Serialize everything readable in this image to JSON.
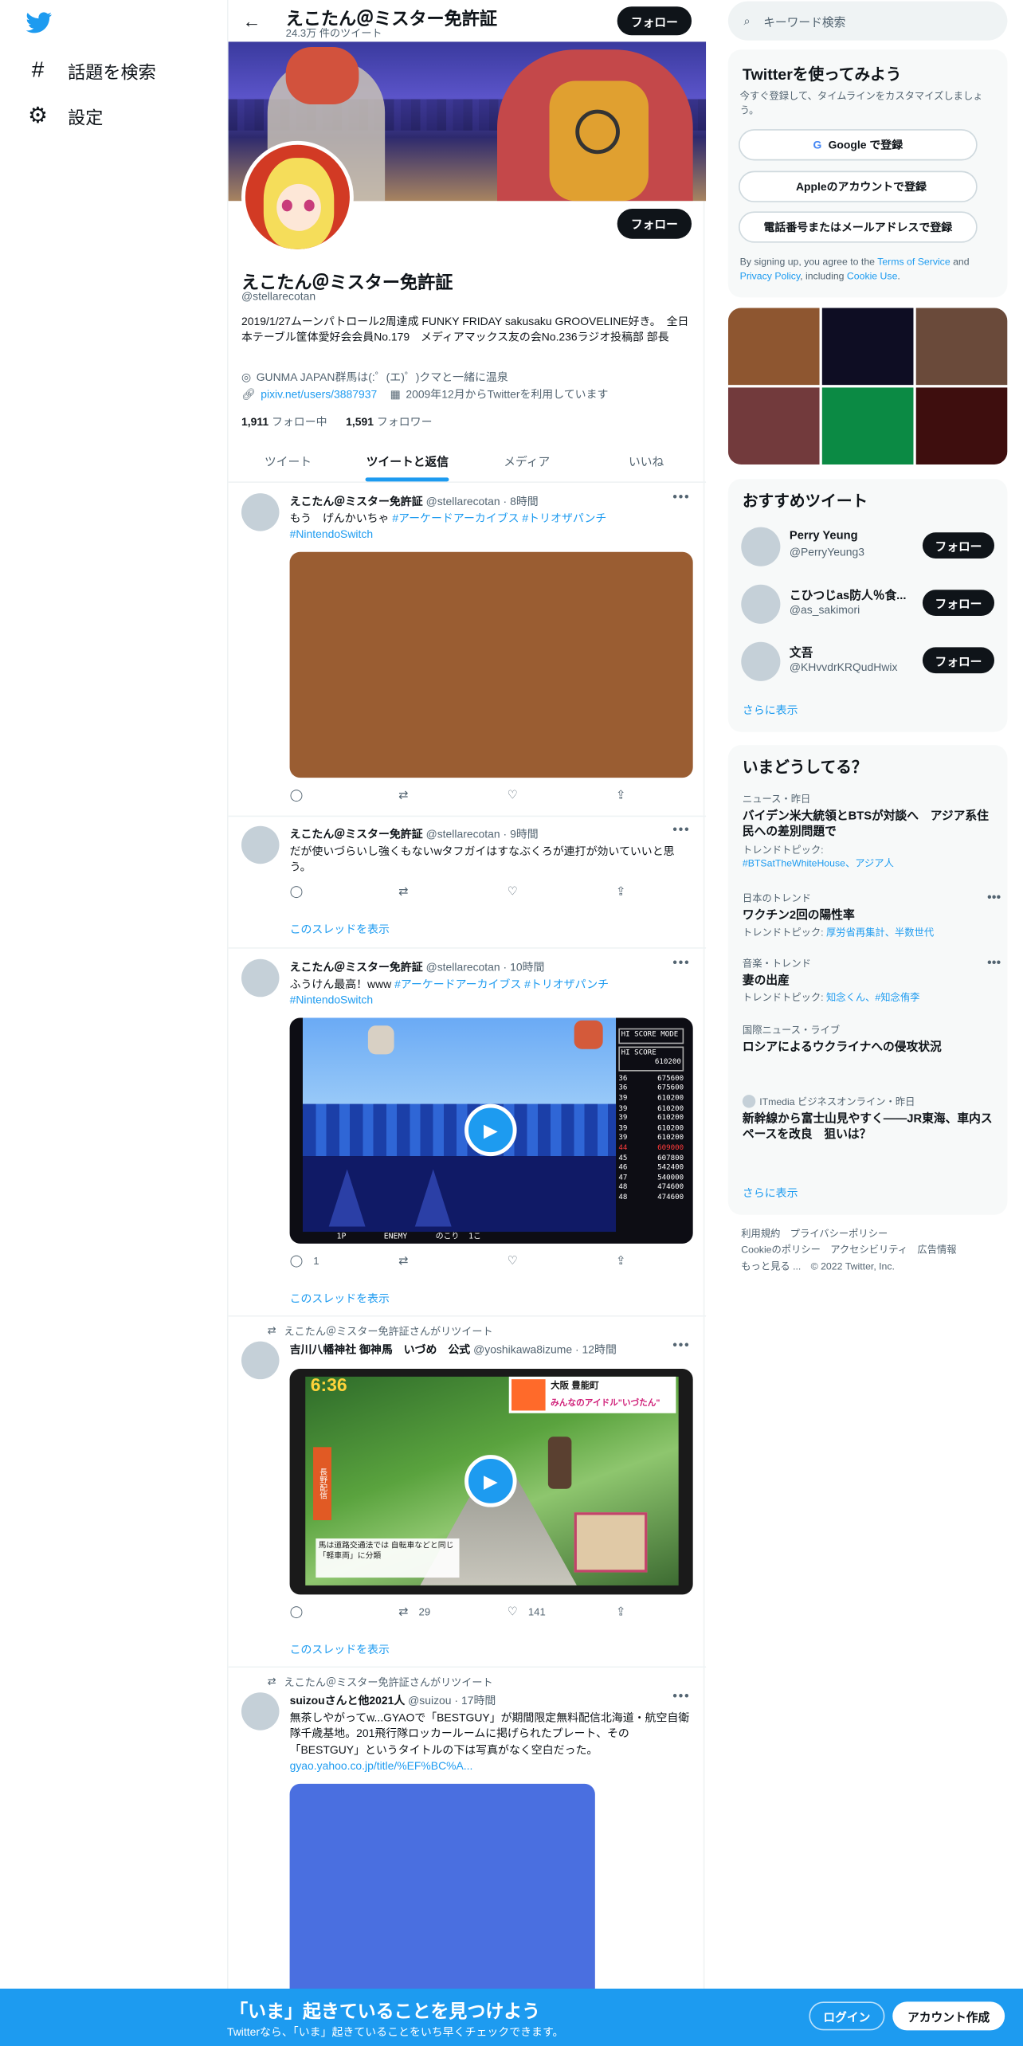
{
  "nav": {
    "explore_label": "話題を検索",
    "settings_label": "設定"
  },
  "header": {
    "name": "えこたん＠ミスター免許証",
    "tweet_count": "24.3万 件のツイート",
    "follow_label": "フォロー"
  },
  "profile": {
    "name": "えこたん＠ミスター免許証",
    "handle": "@stellarecotan",
    "bio": "2019/1/27ムーンパトロール2周達成 FUNKY FRIDAY sakusaku GROOVELINE好き。　全日本テーブル筐体愛好会会員No.179　メディアマックス友の会No.236ラジオ投稿部 部長",
    "location": "GUNMA JAPAN群馬は(:゜(エ)゜)クマと一緒に温泉",
    "url": "pixiv.net/users/3887937",
    "joined": "2009年12月からTwitterを利用しています",
    "following_count": "1,911",
    "following_label": "フォロー中",
    "followers_count": "1,591",
    "followers_label": "フォロワー",
    "follow_label": "フォロー"
  },
  "tabs": [
    {
      "label": "ツイート"
    },
    {
      "label": "ツイートと返信"
    },
    {
      "label": "メディア"
    },
    {
      "label": "いいね"
    }
  ],
  "tweets": [
    {
      "name": "えこたん＠ミスター免許証",
      "handle": "@stellarecotan",
      "time": "8時間",
      "text_plain": "もう　げんかいちゃ ",
      "tags": "#アーケードアーカイブス #トリオザパンチ",
      "tags2": "#NintendoSwitch"
    },
    {
      "name": "えこたん＠ミスター免許証",
      "handle": "@stellarecotan",
      "time": "9時間",
      "text": "だが使いづらいし強くもないwタフガイはすなぶくろが連打が効いていいと思う。",
      "thread_label": "このスレッドを表示"
    },
    {
      "name": "えこたん＠ミスター免許証",
      "handle": "@stellarecotan",
      "time": "10時間",
      "text_plain": "ふうけん最高！www ",
      "tags": "#アーケードアーカイブス #トリオザパンチ",
      "tags2": "#NintendoSwitch",
      "reply_count": "1",
      "thread_label": "このスレッドを表示"
    },
    {
      "rt_label": "えこたん＠ミスター免許証さんがリツイート",
      "name": "吉川八幡神社 御神馬　いづめ　公式",
      "handle": "@yoshikawa8izume",
      "time": "12時間",
      "retweet_count": "29",
      "like_count": "141",
      "thread_label": "このスレッドを表示"
    },
    {
      "rt_label": "えこたん＠ミスター免許証さんがリツイート",
      "name": "suizouさんと他2021人",
      "handle": "@suizou",
      "time": "17時間",
      "text": "無茶しやがってw...GYAOで「BESTGUY」が期間限定無料配信北海道・航空自衛隊千歳基地。201飛行隊ロッカールームに掲げられたプレート、その「BESTGUY」というタイトルの下は写真がなく空白だった。",
      "link": "gyao.yahoo.co.jp/title/%EF%BC%A..."
    }
  ],
  "game_scores": [
    [
      "36",
      "675600"
    ],
    [
      "36",
      "675600"
    ],
    [
      "39",
      "610200"
    ],
    [
      "39",
      "610200"
    ],
    [
      "39",
      "610200"
    ],
    [
      "39",
      "610200"
    ],
    [
      "39",
      "610200"
    ],
    [
      "44",
      "609000"
    ],
    [
      "45",
      "607800"
    ],
    [
      "46",
      "542400"
    ],
    [
      "47",
      "540000"
    ],
    [
      "48",
      "474600"
    ],
    [
      "48",
      "474600"
    ]
  ],
  "game": {
    "hi_score_label": "HI SCORE MODE",
    "hi_label": "HI SCORE",
    "hi_value": "610200",
    "bottom": "1P        ENEMY      のこり  1こ"
  },
  "video2": {
    "time": "6:36",
    "side": "長野配信",
    "caption": "馬は道路交通法では 自転車などと同じ「軽車両」に分類",
    "brand": "みんなのアイドル\"いづたん\"",
    "location": "大阪 豊能町"
  },
  "right": {
    "search_placeholder": "キーワード検索",
    "signup_title": "Twitterを使ってみよう",
    "signup_desc": "今すぐ登録して、タイムラインをカスタマイズしましょう。",
    "google_label": "Google で登録",
    "apple_label": "Appleのアカウントで登録",
    "phone_label": "電話番号またはメールアドレスで登録",
    "terms_1": "By signing up, you agree to the ",
    "terms_link": "Terms of Service",
    "terms_2": " and ",
    "privacy_link": "Privacy Policy",
    "terms_3": ", including ",
    "cookie_link": "Cookie Use",
    "terms_4": ".",
    "recommended_title": "おすすめツイート",
    "recommended": [
      {
        "name": "Perry Yeung",
        "handle": "@PerryYeung3"
      },
      {
        "name": "こひつじas防人％食...",
        "handle": "@as_sakimori"
      },
      {
        "name": "文吾",
        "handle": "@KHvvdrKRQudHwix"
      }
    ],
    "show_more": "さらに表示",
    "trends_title": "いまどうしてる？",
    "trends": [
      {
        "cat": "ニュース・昨日",
        "title": "バイデン米大統領とBTSが対談へ　アジア系住民への差別問題で",
        "sub_label": "トレンドトピック: ",
        "sub": "#BTSatTheWhiteHouse、アジア人"
      },
      {
        "cat": "日本のトレンド",
        "title": "ワクチン2回の陽性率",
        "sub_label": "トレンドトピック: ",
        "sub": "厚労省再集計、半数世代"
      },
      {
        "cat": "音楽・トレンド",
        "title": "妻の出産",
        "sub_label": "トレンドトピック: ",
        "sub": "知念くん、#知念侑李"
      },
      {
        "cat": "国際ニュース・ライブ",
        "title": "ロシアによるウクライナへの侵攻状況",
        "sub_label": "",
        "sub": ""
      },
      {
        "cat": "ITmedia ビジネスオンライン・昨日",
        "title": "新幹線から富士山見やすく――JR東海、車内スペースを改良　狙いは？",
        "sub_label": "",
        "sub": ""
      }
    ],
    "footer_line1": "利用規約　プライバシーポリシー",
    "footer_line2": "Cookieのポリシー　アクセシビリティ　広告情報",
    "footer_line3": "もっと見る ...　© 2022 Twitter, Inc."
  },
  "bottom_bar": {
    "title": "「いま」起きていることを見つけよう",
    "subtitle": "Twitterなら、「いま」起きていることをいち早くチェックできます。",
    "login_label": "ログイン",
    "signup_label": "アカウント作成"
  },
  "colors": {
    "accent": "#1d9bf0",
    "text": "#0f1419",
    "muted": "#536471"
  }
}
